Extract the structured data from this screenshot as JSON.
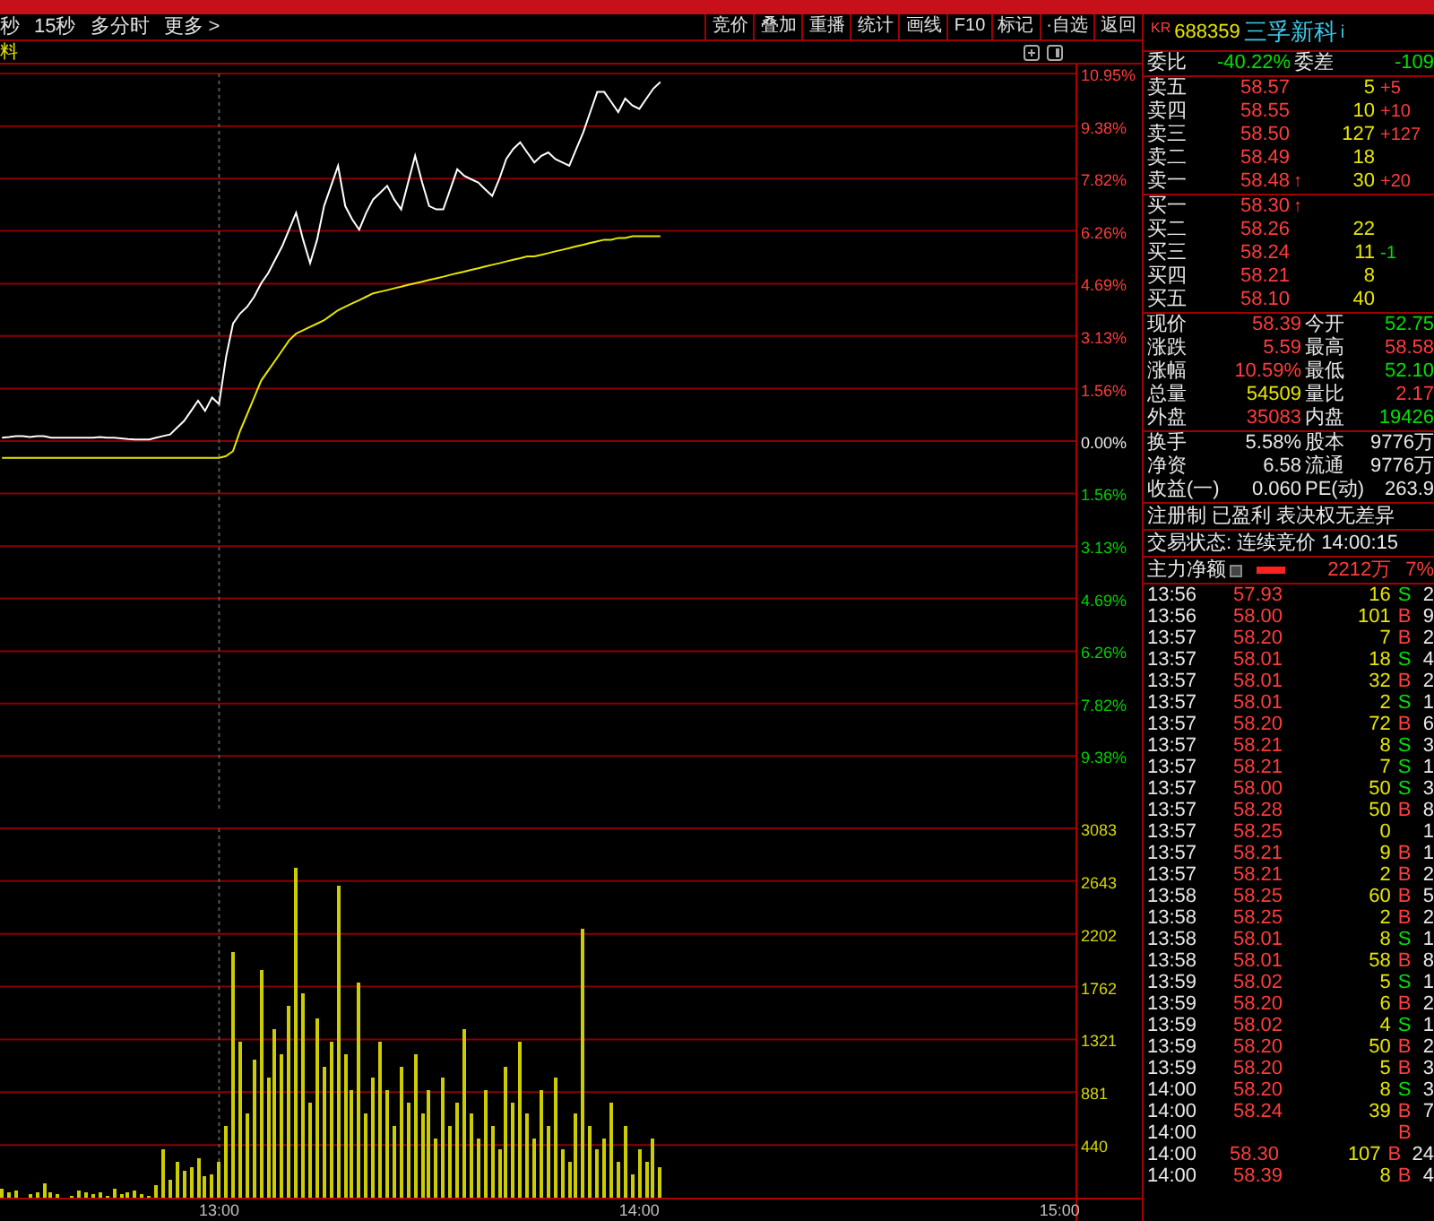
{
  "toolbar": {
    "links": [
      "秒",
      "15秒",
      "多分时",
      "更多 >"
    ],
    "buttons": [
      "竞价",
      "叠加",
      "重播",
      "统计",
      "画线",
      "F10",
      "标记",
      "·自选",
      "返回"
    ]
  },
  "chart_header": {
    "label": "料"
  },
  "price_chart": {
    "chart_data": {
      "type": "line",
      "grid": true,
      "series": [
        {
          "color": "#ffffff",
          "values": [
            0.1,
            0.12,
            0.15,
            0.15,
            0.12,
            0.15,
            0.15,
            0.1,
            0.1,
            0.1,
            0.1,
            0.1,
            0.1,
            0.1,
            0.12,
            0.1,
            0.1,
            0.08,
            0.06,
            0.05,
            0.05,
            0.05,
            0.1,
            0.15,
            0.2,
            0.4,
            0.6,
            0.9,
            1.2,
            0.9,
            1.3,
            1.1,
            2.5,
            3.5,
            3.8,
            4.0,
            4.3,
            4.7,
            5.0,
            5.4,
            5.8,
            6.3,
            6.8,
            6.0,
            5.3,
            6.0,
            7.0,
            7.6,
            8.2,
            7.0,
            6.6,
            6.3,
            6.8,
            7.2,
            7.4,
            7.6,
            7.2,
            6.9,
            7.7,
            8.5,
            7.7,
            7.0,
            6.9,
            6.9,
            7.5,
            8.1,
            7.9,
            7.8,
            7.7,
            7.5,
            7.3,
            7.8,
            8.4,
            8.7,
            8.9,
            8.6,
            8.3,
            8.5,
            8.6,
            8.4,
            8.3,
            8.2,
            8.7,
            9.2,
            9.8,
            10.4,
            10.4,
            10.1,
            9.8,
            10.2,
            10.0,
            9.9,
            10.2,
            10.5,
            10.7,
            null,
            null,
            null,
            null,
            null,
            null,
            null,
            null,
            null,
            null,
            null,
            null,
            null,
            null,
            null,
            null,
            null,
            null,
            null,
            null,
            null,
            null,
            null,
            null,
            null,
            null,
            null,
            null,
            null,
            null,
            null,
            null,
            null,
            null,
            null,
            null,
            null,
            null,
            null,
            null,
            null,
            null,
            null,
            null,
            null,
            null,
            null,
            null,
            null,
            null,
            null,
            null,
            null,
            null,
            null,
            null,
            null,
            null
          ]
        },
        {
          "color": "#e6e600",
          "values": [
            -0.5,
            -0.5,
            -0.5,
            -0.5,
            -0.5,
            -0.5,
            -0.5,
            -0.5,
            -0.5,
            -0.5,
            -0.5,
            -0.5,
            -0.5,
            -0.5,
            -0.5,
            -0.5,
            -0.5,
            -0.5,
            -0.5,
            -0.5,
            -0.5,
            -0.5,
            -0.5,
            -0.5,
            -0.5,
            -0.5,
            -0.5,
            -0.5,
            -0.5,
            -0.5,
            -0.5,
            -0.5,
            -0.45,
            -0.3,
            0.3,
            0.8,
            1.3,
            1.8,
            2.1,
            2.4,
            2.7,
            3.0,
            3.2,
            3.3,
            3.4,
            3.5,
            3.6,
            3.75,
            3.9,
            4.0,
            4.1,
            4.2,
            4.3,
            4.4,
            4.45,
            4.5,
            4.55,
            4.6,
            4.65,
            4.7,
            4.75,
            4.8,
            4.85,
            4.9,
            4.95,
            5.0,
            5.05,
            5.1,
            5.15,
            5.2,
            5.25,
            5.3,
            5.35,
            5.4,
            5.45,
            5.5,
            5.5,
            5.55,
            5.6,
            5.65,
            5.7,
            5.75,
            5.8,
            5.85,
            5.9,
            5.95,
            6.0,
            6.0,
            6.05,
            6.05,
            6.1,
            6.1,
            6.1,
            6.1,
            6.1,
            null,
            null,
            null,
            null,
            null,
            null,
            null,
            null,
            null,
            null,
            null,
            null,
            null,
            null,
            null,
            null,
            null,
            null,
            null,
            null,
            null,
            null,
            null,
            null,
            null,
            null,
            null,
            null,
            null,
            null,
            null,
            null,
            null,
            null,
            null,
            null,
            null,
            null,
            null,
            null,
            null,
            null,
            null,
            null,
            null,
            null,
            null,
            null,
            null,
            null,
            null,
            null,
            null,
            null,
            null,
            null,
            null,
            null
          ]
        }
      ],
      "ylim": [
        -10.95,
        10.95
      ],
      "yticks": [
        {
          "value": 10.95,
          "label": "10.95%"
        },
        {
          "value": 9.38,
          "label": "9.38%"
        },
        {
          "value": 7.82,
          "label": "7.82%"
        },
        {
          "value": 6.26,
          "label": "6.26%"
        },
        {
          "value": 4.69,
          "label": "4.69%"
        },
        {
          "value": 3.13,
          "label": "3.13%"
        },
        {
          "value": 1.56,
          "label": "1.56%"
        },
        {
          "value": 0,
          "label": "0.00%"
        },
        {
          "value": -1.56,
          "label": "1.56%"
        },
        {
          "value": -3.13,
          "label": "3.13%"
        },
        {
          "value": -4.69,
          "label": "4.69%"
        },
        {
          "value": -6.26,
          "label": "6.26%"
        },
        {
          "value": -7.82,
          "label": "7.82%"
        },
        {
          "value": -9.38,
          "label": "9.38%"
        }
      ]
    }
  },
  "volume_chart": {
    "chart_data": {
      "type": "bar",
      "grid": true,
      "categories": [
        null,
        null,
        null,
        null,
        null,
        null,
        null,
        null,
        null,
        null,
        null,
        null,
        null,
        null,
        null,
        null,
        null,
        null,
        null,
        null,
        null,
        null,
        null,
        null,
        null,
        null,
        null,
        null,
        null,
        null,
        null,
        "13:00",
        null,
        null,
        null,
        null,
        null,
        null,
        null,
        null,
        null,
        null,
        null,
        null,
        null,
        null,
        null,
        null,
        null,
        null,
        null,
        null,
        null,
        null,
        null,
        null,
        null,
        null,
        null,
        null,
        null,
        null,
        null,
        null,
        null,
        null,
        null,
        null,
        null,
        null,
        null,
        null,
        null,
        null,
        null,
        null,
        null,
        null,
        null,
        null,
        null,
        null,
        null,
        null,
        null,
        null,
        null,
        null,
        null,
        null,
        null,
        "14:00",
        null,
        null,
        null,
        null,
        null,
        null,
        null,
        null,
        null,
        null,
        null,
        null,
        null,
        null,
        null,
        null,
        null,
        null,
        null,
        null,
        null,
        null,
        null,
        null,
        null,
        null,
        null,
        null,
        null,
        null,
        null,
        null,
        null,
        null,
        null,
        null,
        null,
        null,
        null,
        null,
        null,
        null,
        null,
        null,
        null,
        null,
        null,
        null,
        null,
        null,
        null,
        null,
        null,
        null,
        null,
        null,
        null,
        null,
        null,
        "15:00",
        null
      ],
      "series": [
        {
          "color": "#cccc00",
          "values": [
            80,
            40,
            60,
            0,
            30,
            50,
            120,
            40,
            30,
            0,
            20,
            60,
            40,
            30,
            50,
            20,
            80,
            30,
            40,
            60,
            30,
            20,
            100,
            400,
            150,
            300,
            220,
            250,
            330,
            180,
            200,
            300,
            600,
            2050,
            1300,
            700,
            1150,
            1900,
            1000,
            1400,
            1200,
            1600,
            2750,
            1700,
            800,
            1500,
            1100,
            1300,
            2600,
            1200,
            900,
            1800,
            700,
            1000,
            1300,
            900,
            600,
            1100,
            800,
            1200,
            700,
            900,
            500,
            1000,
            600,
            800,
            1400,
            700,
            500,
            900,
            600,
            400,
            1100,
            800,
            1300,
            700,
            500,
            900,
            600,
            1000,
            400,
            300,
            700,
            2250,
            600,
            400,
            500,
            800,
            300,
            600,
            200,
            400,
            300,
            500,
            250,
            null,
            null,
            null,
            null,
            null,
            null,
            null,
            null,
            null,
            null,
            null,
            null,
            null,
            null,
            null,
            null,
            null,
            null,
            null,
            null,
            null,
            null,
            null,
            null,
            null,
            null,
            null,
            null,
            null,
            null,
            null,
            null,
            null,
            null,
            null,
            null,
            null,
            null,
            null,
            null,
            null,
            null,
            null,
            null,
            null,
            null,
            null,
            null,
            null,
            null,
            null,
            null,
            null,
            null,
            null,
            null,
            null,
            null
          ]
        }
      ],
      "ylim": [
        0,
        3083
      ],
      "yticks": [
        440,
        881,
        1321,
        1762,
        2202,
        2643,
        3083
      ]
    }
  },
  "quote": {
    "market": "KR",
    "code": "688359",
    "name": "三孚新科",
    "info": "i",
    "ratio": {
      "label": "委比",
      "value": "-40.22%",
      "diff_label": "委差",
      "diff": "-109",
      "color": "#00e000"
    },
    "asks": [
      {
        "label": "卖五",
        "price": "58.57",
        "volume": "5",
        "change": {
          "text": "+5",
          "color": "#ff3c3c"
        }
      },
      {
        "label": "卖四",
        "price": "58.55",
        "volume": "10",
        "change": {
          "text": "+10",
          "color": "#ff3c3c"
        }
      },
      {
        "label": "卖三",
        "price": "58.50",
        "volume": "127",
        "change": {
          "text": "+127",
          "color": "#ff3c3c"
        }
      },
      {
        "label": "卖二",
        "price": "58.49",
        "volume": "18"
      },
      {
        "label": "卖一",
        "price": "58.48",
        "flag": "↑",
        "volume": "30",
        "change": {
          "text": "+20",
          "color": "#ff3c3c"
        }
      }
    ],
    "bids": [
      {
        "label": "买一",
        "price": "58.30",
        "flag": "↑"
      },
      {
        "label": "买二",
        "price": "58.26",
        "volume": "22"
      },
      {
        "label": "买三",
        "price": "58.24",
        "volume": "11",
        "change": {
          "text": "-1",
          "color": "#00e000"
        }
      },
      {
        "label": "买四",
        "price": "58.21",
        "volume": "8"
      },
      {
        "label": "买五",
        "price": "58.10",
        "volume": "40"
      }
    ],
    "stats": [
      {
        "label": "现价",
        "value": "58.39",
        "color": "#ff3c3c"
      },
      {
        "label": "今开",
        "value": "52.75",
        "color": "#00e000"
      },
      {
        "label": "涨跌",
        "value": "5.59",
        "color": "#ff3c3c"
      },
      {
        "label": "最高",
        "value": "58.58",
        "color": "#ff3c3c"
      },
      {
        "label": "涨幅",
        "value": "10.59%",
        "color": "#ff3c3c"
      },
      {
        "label": "最低",
        "value": "52.10",
        "color": "#00e000"
      },
      {
        "label": "总量",
        "value": "54509",
        "color": "#e6e600"
      },
      {
        "label": "量比",
        "value": "2.17",
        "color": "#ff3c3c"
      },
      {
        "label": "外盘",
        "value": "35083",
        "color": "#ff3c3c"
      },
      {
        "label": "内盘",
        "value": "19426",
        "color": "#00e000"
      }
    ],
    "extra": [
      {
        "label": "换手",
        "value": "5.58%"
      },
      {
        "label": "股本",
        "value": "9776万"
      },
      {
        "label": "净资",
        "value": "6.58"
      },
      {
        "label": "流通",
        "value": "9776万"
      },
      {
        "label": "收益(一)",
        "value": "0.060"
      },
      {
        "label": "PE(动)",
        "value": "263.9"
      }
    ],
    "notice": "注册制 已盈利 表决权无差异",
    "status": "交易状态: 连续竞价 14:00:15",
    "flow": {
      "label": "主力净额",
      "value": "2212万",
      "percent": "7%"
    }
  },
  "trades": [
    {
      "time": "13:56",
      "price": "57.93",
      "volume": "16",
      "side": "S",
      "color": "#00e000",
      "column_5": "2"
    },
    {
      "time": "13:56",
      "price": "58.00",
      "volume": "101",
      "side": "B",
      "color": "#ff3c3c",
      "column_5": "9"
    },
    {
      "time": "13:57",
      "price": "58.20",
      "volume": "7",
      "side": "B",
      "color": "#ff3c3c",
      "column_5": "2"
    },
    {
      "time": "13:57",
      "price": "58.01",
      "volume": "18",
      "side": "S",
      "color": "#00e000",
      "column_5": "4"
    },
    {
      "time": "13:57",
      "price": "58.01",
      "volume": "32",
      "side": "B",
      "color": "#ff3c3c",
      "column_5": "2"
    },
    {
      "time": "13:57",
      "price": "58.01",
      "volume": "2",
      "side": "S",
      "color": "#00e000",
      "column_5": "1"
    },
    {
      "time": "13:57",
      "price": "58.20",
      "volume": "72",
      "side": "B",
      "color": "#ff3c3c",
      "column_5": "6"
    },
    {
      "time": "13:57",
      "price": "58.21",
      "volume": "8",
      "side": "S",
      "color": "#00e000",
      "column_5": "3"
    },
    {
      "time": "13:57",
      "price": "58.21",
      "volume": "7",
      "side": "S",
      "color": "#00e000",
      "column_5": "1"
    },
    {
      "time": "13:57",
      "price": "58.00",
      "volume": "50",
      "side": "S",
      "color": "#00e000",
      "column_5": "3"
    },
    {
      "time": "13:57",
      "price": "58.28",
      "volume": "50",
      "side": "B",
      "color": "#ff3c3c",
      "column_5": "8"
    },
    {
      "time": "13:57",
      "price": "58.25",
      "volume": "0",
      "column_5": "1"
    },
    {
      "time": "13:57",
      "price": "58.21",
      "volume": "9",
      "side": "B",
      "color": "#ff3c3c",
      "column_5": "1"
    },
    {
      "time": "13:57",
      "price": "58.21",
      "volume": "2",
      "side": "B",
      "color": "#ff3c3c",
      "column_5": "2"
    },
    {
      "time": "13:58",
      "price": "58.25",
      "volume": "60",
      "side": "B",
      "color": "#ff3c3c",
      "column_5": "5"
    },
    {
      "time": "13:58",
      "price": "58.25",
      "volume": "2",
      "side": "B",
      "color": "#ff3c3c",
      "column_5": "2"
    },
    {
      "time": "13:58",
      "price": "58.01",
      "volume": "8",
      "side": "S",
      "color": "#00e000",
      "column_5": "1"
    },
    {
      "time": "13:58",
      "price": "58.01",
      "volume": "58",
      "side": "B",
      "color": "#ff3c3c",
      "column_5": "8"
    },
    {
      "time": "13:59",
      "price": "58.02",
      "volume": "5",
      "side": "S",
      "color": "#00e000",
      "column_5": "1"
    },
    {
      "time": "13:59",
      "price": "58.20",
      "volume": "6",
      "side": "B",
      "color": "#ff3c3c",
      "column_5": "2"
    },
    {
      "time": "13:59",
      "price": "58.02",
      "volume": "4",
      "side": "S",
      "color": "#00e000",
      "column_5": "1"
    },
    {
      "time": "13:59",
      "price": "58.20",
      "volume": "50",
      "side": "B",
      "color": "#ff3c3c",
      "column_5": "2"
    },
    {
      "time": "13:59",
      "price": "58.20",
      "volume": "5",
      "side": "B",
      "color": "#ff3c3c",
      "column_5": "3"
    },
    {
      "time": "14:00",
      "price": "58.20",
      "volume": "8",
      "side": "S",
      "color": "#00e000",
      "column_5": "3"
    },
    {
      "time": "14:00",
      "price": "58.24",
      "volume": "39",
      "side": "B",
      "color": "#ff3c3c",
      "column_5": "7"
    },
    {
      "time": "14:00",
      "side": "B",
      "color": "#ff3c3c"
    },
    {
      "time": "14:00",
      "price": "58.30",
      "volume": "107",
      "side": "B",
      "color": "#ff3c3c",
      "column_5": "24"
    },
    {
      "time": "14:00",
      "price": "58.39",
      "volume": "8",
      "side": "B",
      "color": "#ff3c3c",
      "column_5": "4"
    }
  ]
}
